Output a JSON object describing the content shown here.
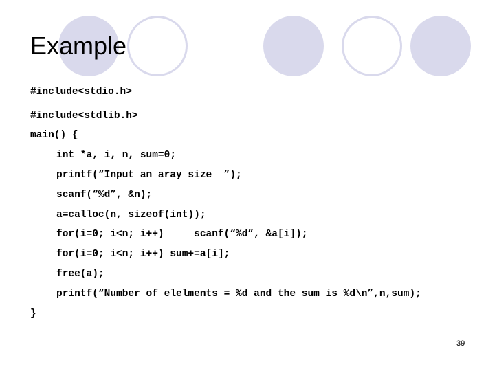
{
  "slide": {
    "title": "Example",
    "page_number": "39",
    "decoration_color": "#d9d9ec",
    "code_lines": [
      "#include<stdio.h>",
      "#include<stdlib.h>",
      "main() {",
      "int *a, i, n, sum=0;",
      "printf(“Input an aray size  ”);",
      "scanf(“%d”, &n);",
      "a=calloc(n, sizeof(int));",
      "for(i=0; i<n; i++)     scanf(“%d”, &a[i]);",
      "for(i=0; i<n; i++) sum+=a[i];",
      "free(a);",
      "printf(“Number of elelments = %d and the sum is %d\\n”,n,sum);",
      "}"
    ]
  }
}
